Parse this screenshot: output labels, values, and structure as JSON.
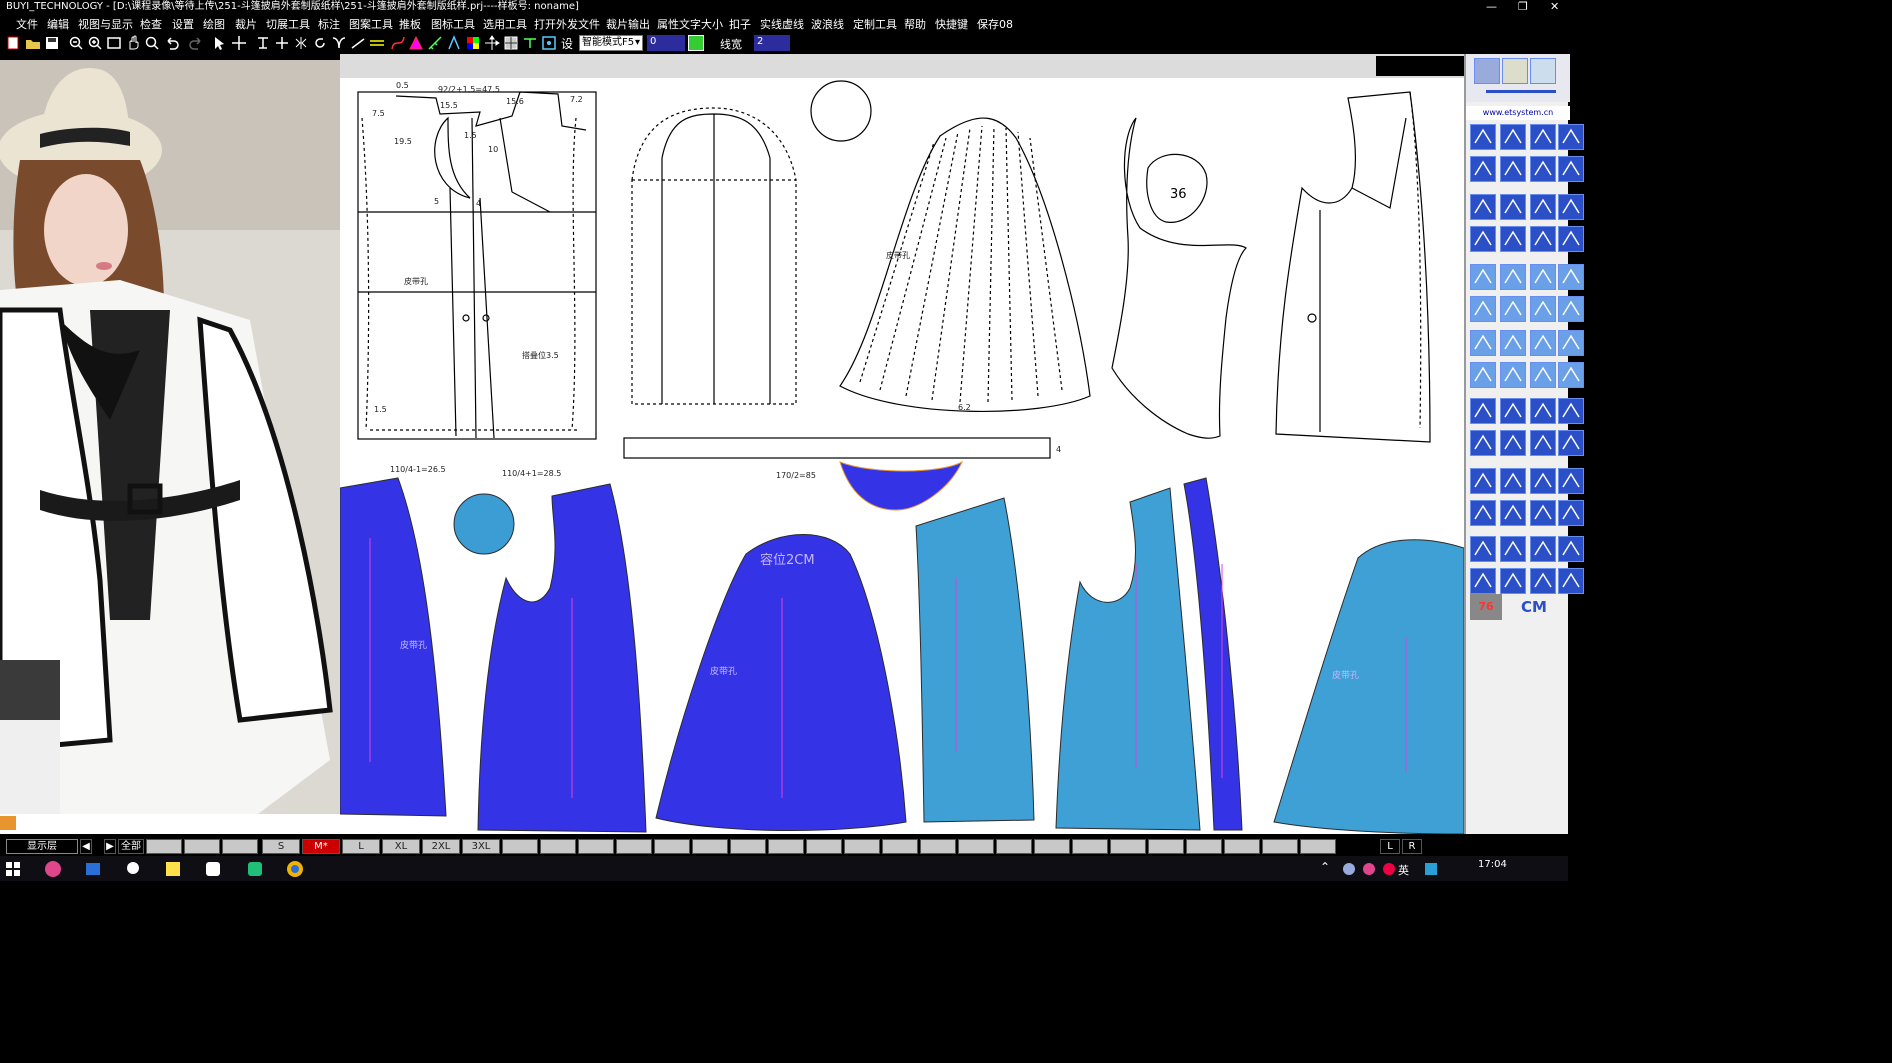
{
  "app": {
    "title": "BUYI_TECHNOLOGY - [D:\\课程录像\\等待上传\\251-斗篷披肩外套制版纸样\\251-斗篷披肩外套制版纸样.prj----样板号: noname]"
  },
  "menu": [
    "文件",
    "编辑",
    "视图与显示",
    "检查",
    "设置",
    "绘图",
    "裁片",
    "切展工具",
    "标注",
    "图案工具",
    "推板",
    "图标工具",
    "选用工具",
    "打开外发文件",
    "裁片输出",
    "属性文字大小",
    "扣子",
    "实线虚线",
    "波浪线",
    "定制工具",
    "帮助",
    "快捷键",
    "保存08"
  ],
  "toolbar": {
    "mode_select": "智能模式F5",
    "value_field": "0",
    "line_width_label": "线宽",
    "line_width_value": "2"
  },
  "right_panel": {
    "site": "www.etsystem.cn",
    "size_badge": "76",
    "unit": "CM"
  },
  "drawing": {
    "top_labels": {
      "a": "0.5",
      "b": "92/2+1.5=47.5",
      "c": "15.5",
      "d": "15.6",
      "e": "7.2",
      "f": "7.5",
      "g": "19.5",
      "h": "10",
      "i": "1.5",
      "j": "4",
      "k": "5",
      "belt_hole": "皮带孔",
      "placket": "搭叠位3.5",
      "hem": "1.5",
      "bottom1": "110/4-1=26.5",
      "bottom2": "110/4+1=28.5",
      "collar_len": "170/2=85",
      "sleeve_belt": "皮带孔",
      "fit_num": "36",
      "side_num": "4",
      "sleeve_hem": "6.2"
    },
    "piece_labels": {
      "front_fold": "皮带孔",
      "tie": "皮带孔",
      "ease": "容位2CM",
      "skirt_belt": "皮带孔",
      "belt_right": "皮带孔"
    }
  },
  "statusbar": {
    "layer_label": "显示层",
    "all_label": "全部",
    "sizes": [
      "S",
      "M*",
      "L",
      "XL",
      "2XL",
      "3XL"
    ],
    "right_l": "L",
    "right_r": "R"
  },
  "taskbar": {
    "time": "17:04",
    "lang": "英"
  }
}
